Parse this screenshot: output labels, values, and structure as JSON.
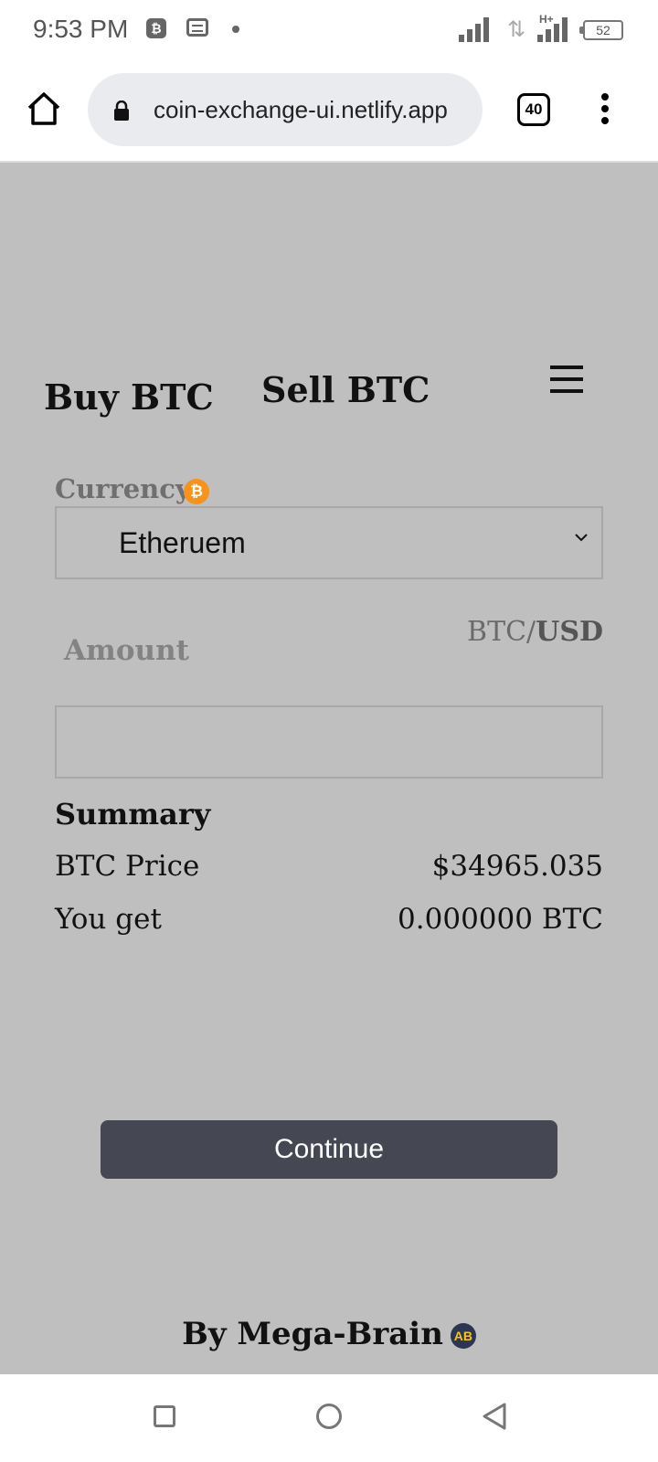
{
  "status_bar": {
    "time": "9:53 PM",
    "notification_icons": [
      "bitcoin-app-icon",
      "message-icon",
      "dot-icon"
    ],
    "battery": "52"
  },
  "browser": {
    "url": "coin-exchange-ui.netlify.app",
    "tab_count": "40"
  },
  "tabs": {
    "buy": "Buy BTC",
    "sell": "Sell BTC"
  },
  "form": {
    "currency_label": "Currency",
    "currency_value": "Etheruem",
    "amount_label": "Amount",
    "pair_base": "BTC/",
    "pair_quote": "USD",
    "amount_value": ""
  },
  "summary": {
    "title": "Summary",
    "price_label": "BTC Price",
    "price_value": "$34965.035",
    "get_label": "You get",
    "get_value": "0.000000 BTC"
  },
  "actions": {
    "continue_label": "Continue"
  },
  "footer": {
    "credit": "By Mega-Brain",
    "logo_text": "AB"
  },
  "colors": {
    "content_bg": "#bfbfbf",
    "button_bg": "#454753",
    "bitcoin_orange": "#f7931a"
  }
}
